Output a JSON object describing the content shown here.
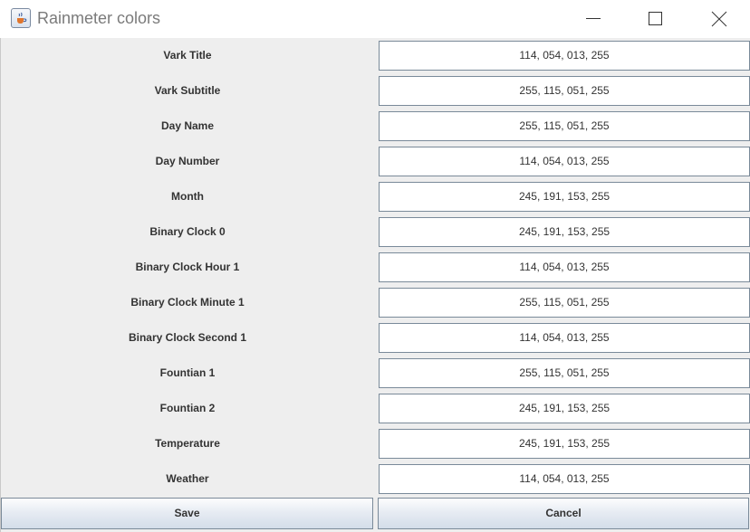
{
  "window": {
    "title": "Rainmeter colors"
  },
  "rows": [
    {
      "label": "Vark Title",
      "value": "114, 054, 013, 255"
    },
    {
      "label": "Vark Subtitle",
      "value": "255, 115, 051, 255"
    },
    {
      "label": "Day Name",
      "value": "255, 115, 051, 255"
    },
    {
      "label": "Day Number",
      "value": "114, 054, 013, 255"
    },
    {
      "label": "Month",
      "value": "245, 191, 153, 255"
    },
    {
      "label": "Binary Clock 0",
      "value": "245, 191, 153, 255"
    },
    {
      "label": "Binary Clock Hour 1",
      "value": "114, 054, 013, 255"
    },
    {
      "label": "Binary Clock Minute 1",
      "value": "255, 115, 051, 255"
    },
    {
      "label": "Binary Clock Second 1",
      "value": "114, 054, 013, 255"
    },
    {
      "label": "Fountian 1",
      "value": "255, 115, 051, 255"
    },
    {
      "label": "Fountian 2",
      "value": "245, 191, 153, 255"
    },
    {
      "label": "Temperature",
      "value": "245, 191, 153, 255"
    },
    {
      "label": "Weather",
      "value": "114, 054, 013, 255"
    }
  ],
  "buttons": {
    "save": "Save",
    "cancel": "Cancel"
  },
  "icons": {
    "app": "java-cup-icon",
    "minimize": "minimize-icon",
    "maximize": "maximize-icon",
    "close": "close-icon"
  }
}
